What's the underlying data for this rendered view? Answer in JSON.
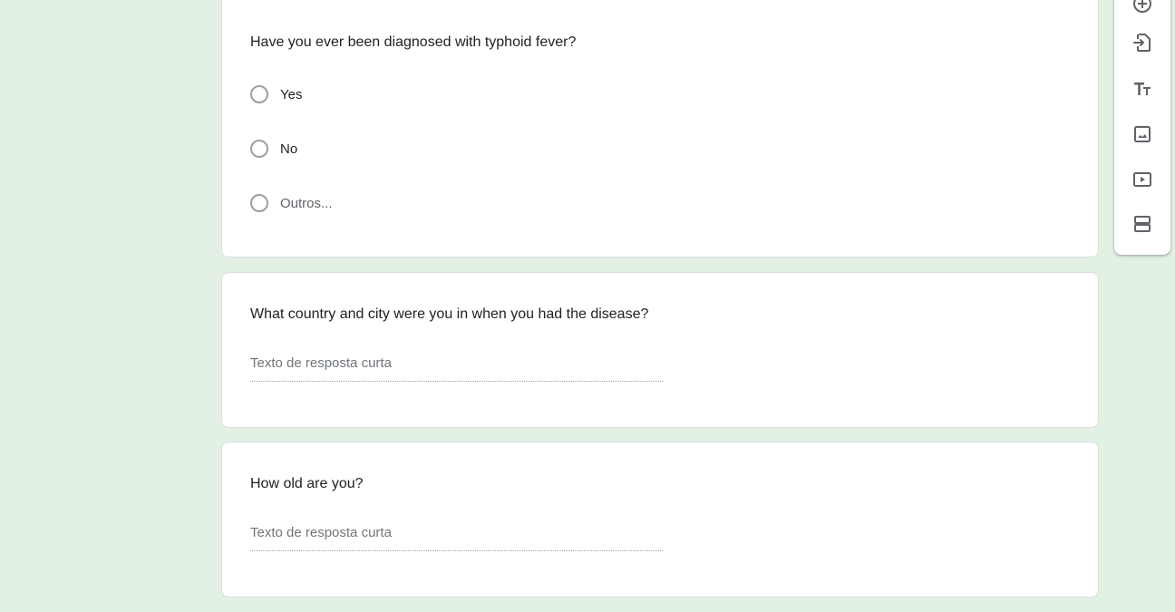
{
  "questions": [
    {
      "title": "Have you ever been diagnosed with typhoid fever?",
      "type": "multiple-choice",
      "options": [
        "Yes",
        "No",
        "Outros..."
      ]
    },
    {
      "title": "What country and city were you in when you had the disease?",
      "type": "short-answer",
      "placeholder": "Texto de resposta curta"
    },
    {
      "title": "How old are you?",
      "type": "short-answer",
      "placeholder": "Texto de resposta curta"
    }
  ],
  "toolbar": {
    "icons": [
      "add-question-icon",
      "import-questions-icon",
      "add-title-icon",
      "add-image-icon",
      "add-video-icon",
      "add-section-icon"
    ]
  },
  "colors": {
    "background": "#e3f1e5",
    "card": "#ffffff",
    "radio_border": "#9e9e9e",
    "icon": "#5f6368"
  }
}
